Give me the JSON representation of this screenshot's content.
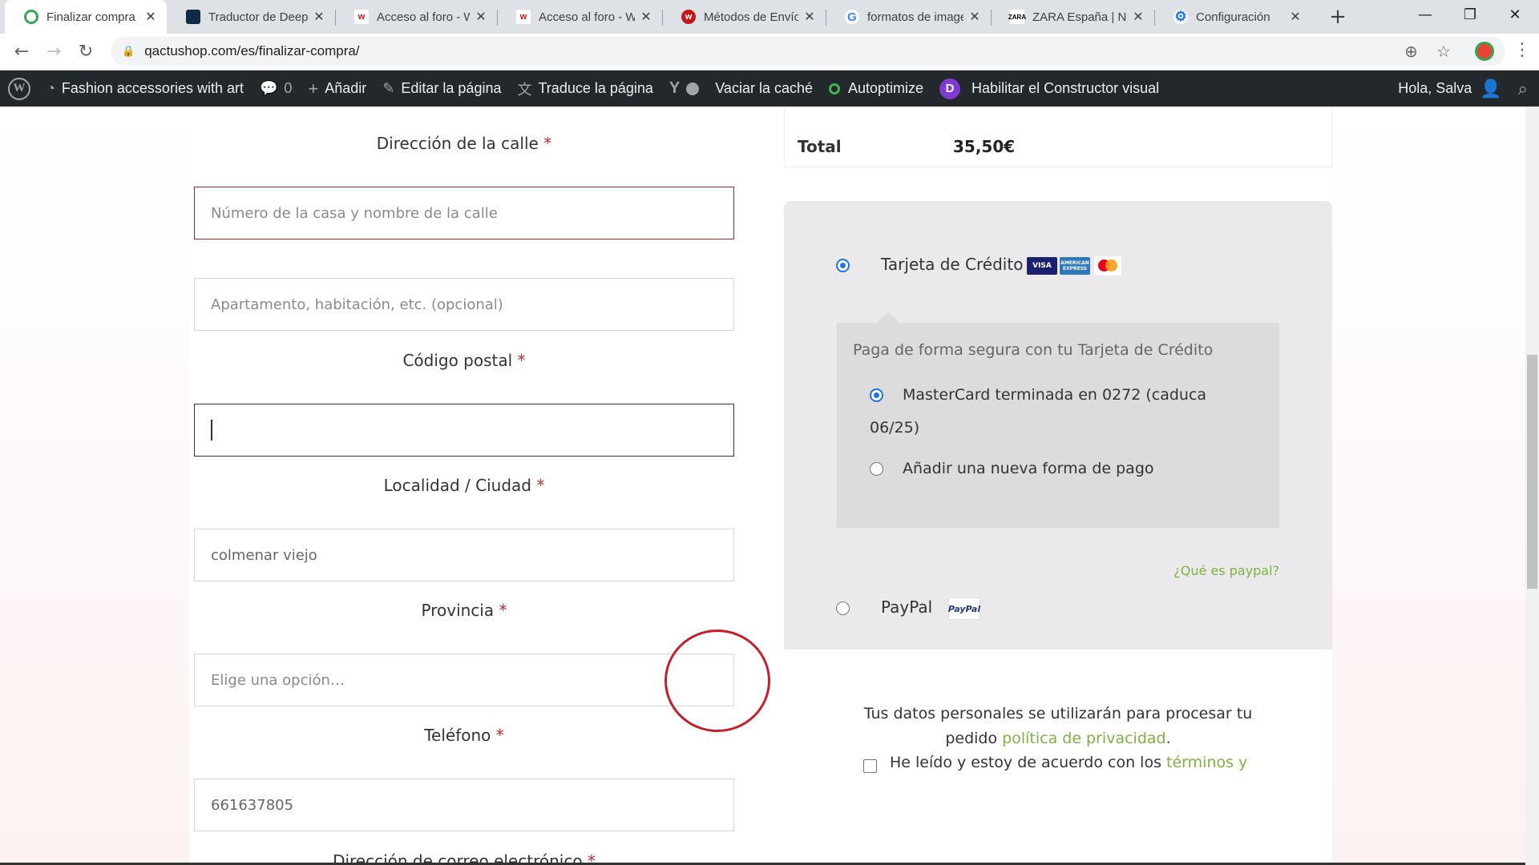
{
  "browser": {
    "tabs": [
      {
        "title": "Finalizar compra -",
        "active": true,
        "icon": "tab-favicon-qactushop"
      },
      {
        "title": "Traductor de Deep",
        "active": false,
        "icon": "deepl-icon"
      },
      {
        "title": "Acceso al foro - W",
        "active": false,
        "icon": "wordfence-icon"
      },
      {
        "title": "Acceso al foro - W",
        "active": false,
        "icon": "wordfence-icon"
      },
      {
        "title": "Métodos de Envío",
        "active": false,
        "icon": "wordfence-icon"
      },
      {
        "title": "formatos de image",
        "active": false,
        "icon": "google-icon"
      },
      {
        "title": "ZARA España | Nu",
        "active": false,
        "icon": "zara-icon"
      },
      {
        "title": "Configuración",
        "active": false,
        "icon": "settings-gear-icon"
      }
    ],
    "url": "qactushop.com/es/finalizar-compra/"
  },
  "adminbar": {
    "site_name": "Fashion accessories with art",
    "comments_count": "0",
    "add_label": "Añadir",
    "edit_label": "Editar la página",
    "translate_label": "Traduce la página",
    "cache_label": "Vaciar la caché",
    "autoptimize_label": "Autoptimize",
    "divi_label": "Habilitar el Constructor visual",
    "greeting": "Hola, Salva"
  },
  "form": {
    "street": {
      "label": "Dirección de la calle",
      "placeholder": "Número de la casa y nombre de la calle"
    },
    "apartment": {
      "placeholder": "Apartamento, habitación, etc. (opcional)"
    },
    "postcode": {
      "label": "Código postal",
      "value": ""
    },
    "city": {
      "label": "Localidad / Ciudad",
      "value": "colmenar viejo"
    },
    "province": {
      "label": "Provincia",
      "placeholder": "Elige una opción…"
    },
    "phone": {
      "label": "Teléfono",
      "value": "661637805"
    },
    "email": {
      "label": "Dirección de correo electrónico"
    },
    "required_mark": "*"
  },
  "order": {
    "total_label": "Total",
    "total_value": "35,50€"
  },
  "payment": {
    "credit_card_label": "Tarjeta de Crédito",
    "card_logos": [
      "VISA",
      "AMERICAN EXPRESS",
      "MasterCard"
    ],
    "cc_description": "Paga de forma segura con tu Tarjeta de Crédito",
    "saved_card_line1": "MasterCard terminada en 0272 (caduca",
    "saved_card_line2": "06/25)",
    "new_method_label": "Añadir una nueva forma de pago",
    "paypal_link": "¿Qué es paypal?",
    "paypal_label": "PayPal",
    "paypal_logo": "PayPal"
  },
  "privacy": {
    "text": "Tus datos personales se utilizarán para procesar tu pedido",
    "link": "política de privacidad",
    "end": "."
  },
  "terms": {
    "text": "He leído y estoy de acuerdo con los",
    "link": "términos y"
  },
  "colors": {
    "accent_link": "#7cb342",
    "required": "#c92a2a",
    "adminbar_bg": "#23282d",
    "highlight_circle": "#c41f2a",
    "payment_bg": "#ebe9eb"
  }
}
